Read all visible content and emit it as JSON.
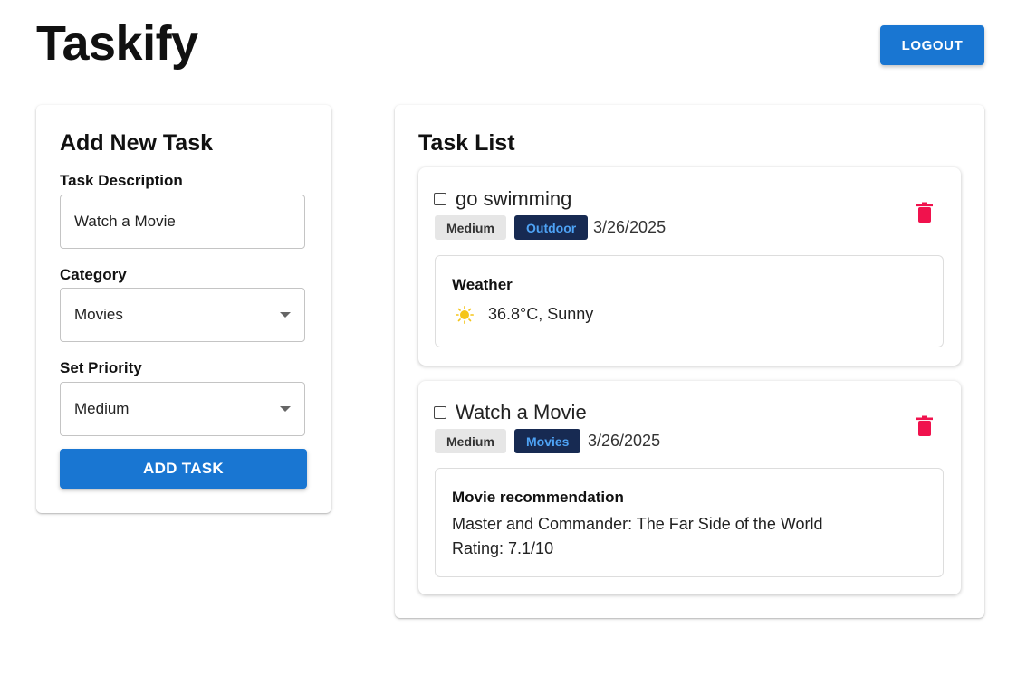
{
  "header": {
    "app_title": "Taskify",
    "logout_label": "LOGOUT"
  },
  "add_task": {
    "title": "Add New Task",
    "description_label": "Task Description",
    "description_value": "Watch a Movie",
    "category_label": "Category",
    "category_value": "Movies",
    "priority_label": "Set Priority",
    "priority_value": "Medium",
    "add_button_label": "ADD TASK"
  },
  "task_list": {
    "title": "Task List",
    "tasks": [
      {
        "name": "go swimming",
        "priority": "Medium",
        "category": "Outdoor",
        "date": "3/26/2025",
        "completed": false,
        "info_title": "Weather",
        "weather_icon": "sun-icon",
        "weather_text": "36.8°C, Sunny"
      },
      {
        "name": "Watch a Movie",
        "priority": "Medium",
        "category": "Movies",
        "date": "3/26/2025",
        "completed": false,
        "info_title": "Movie recommendation",
        "movie_title": "Master and Commander: The Far Side of the World",
        "rating": "Rating: 7.1/10"
      }
    ]
  },
  "colors": {
    "primary": "#1976d2",
    "delete": "#f0124d",
    "category_chip_bg": "#172a52",
    "category_chip_text": "#4ea3f5",
    "priority_chip_bg": "#e6e6e6",
    "sun": "#f5c518"
  },
  "icons": {
    "delete": "trash-icon",
    "dropdown": "chevron-down-icon",
    "weather": "sun-icon"
  }
}
